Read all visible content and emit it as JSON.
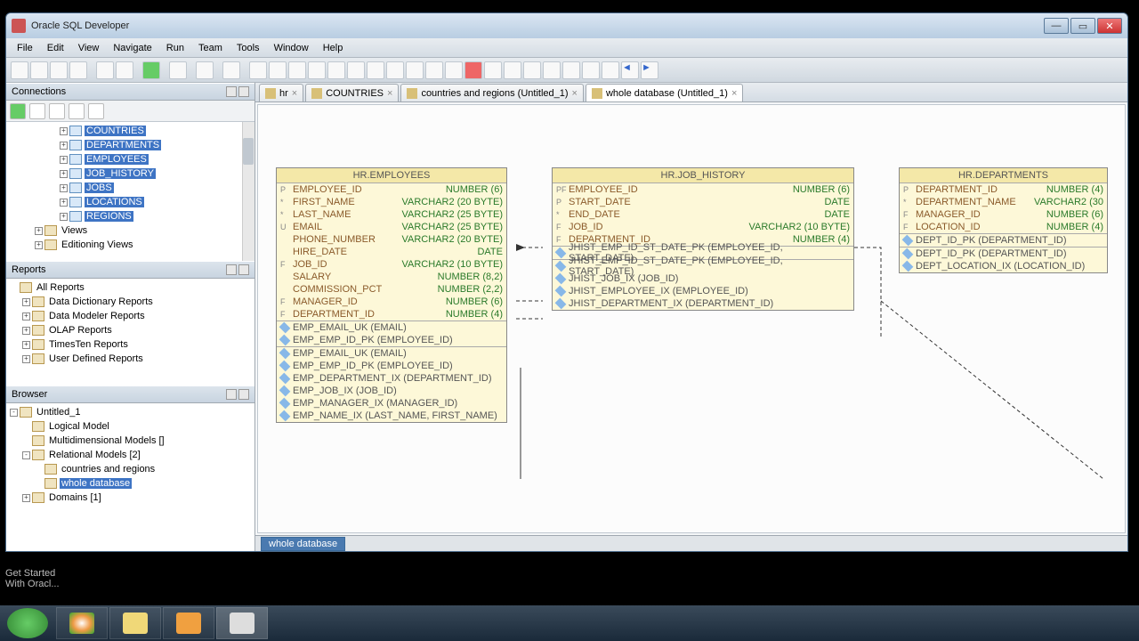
{
  "title": "Oracle SQL Developer",
  "menu": [
    "File",
    "Edit",
    "View",
    "Navigate",
    "Run",
    "Team",
    "Tools",
    "Window",
    "Help"
  ],
  "footer_lines": [
    "Get Started",
    "With Oracl..."
  ],
  "panels": {
    "connections": "Connections",
    "reports": "Reports",
    "browser": "Browser"
  },
  "conn_tree": [
    {
      "lvl": 4,
      "exp": "+",
      "sel": true,
      "label": "COUNTRIES",
      "type": "tbl"
    },
    {
      "lvl": 4,
      "exp": "+",
      "sel": true,
      "label": "DEPARTMENTS",
      "type": "tbl"
    },
    {
      "lvl": 4,
      "exp": "+",
      "sel": true,
      "label": "EMPLOYEES",
      "type": "tbl"
    },
    {
      "lvl": 4,
      "exp": "+",
      "sel": true,
      "label": "JOB_HISTORY",
      "type": "tbl"
    },
    {
      "lvl": 4,
      "exp": "+",
      "sel": true,
      "label": "JOBS",
      "type": "tbl"
    },
    {
      "lvl": 4,
      "exp": "+",
      "sel": true,
      "label": "LOCATIONS",
      "type": "tbl"
    },
    {
      "lvl": 4,
      "exp": "+",
      "sel": true,
      "label": "REGIONS",
      "type": "tbl"
    },
    {
      "lvl": 2,
      "exp": "+",
      "sel": false,
      "label": "Views",
      "type": "fld"
    },
    {
      "lvl": 2,
      "exp": "+",
      "sel": false,
      "label": "Editioning Views",
      "type": "fld"
    }
  ],
  "reports_tree": [
    {
      "lvl": 0,
      "exp": "",
      "label": "All Reports"
    },
    {
      "lvl": 1,
      "exp": "+",
      "label": "Data Dictionary Reports"
    },
    {
      "lvl": 1,
      "exp": "+",
      "label": "Data Modeler Reports"
    },
    {
      "lvl": 1,
      "exp": "+",
      "label": "OLAP Reports"
    },
    {
      "lvl": 1,
      "exp": "+",
      "label": "TimesTen Reports"
    },
    {
      "lvl": 1,
      "exp": "+",
      "label": "User Defined Reports"
    }
  ],
  "browser_tree": [
    {
      "lvl": 0,
      "exp": "-",
      "label": "Untitled_1",
      "sel": false
    },
    {
      "lvl": 1,
      "exp": "",
      "label": "Logical Model",
      "sel": false
    },
    {
      "lvl": 1,
      "exp": "",
      "label": "Multidimensional Models []",
      "sel": false
    },
    {
      "lvl": 1,
      "exp": "-",
      "label": "Relational Models [2]",
      "sel": false
    },
    {
      "lvl": 2,
      "exp": "",
      "label": "countries and regions",
      "sel": false
    },
    {
      "lvl": 2,
      "exp": "",
      "label": "whole database",
      "sel": true
    },
    {
      "lvl": 1,
      "exp": "+",
      "label": "Domains [1]",
      "sel": false
    }
  ],
  "tabs": [
    {
      "label": "hr",
      "active": false
    },
    {
      "label": "COUNTRIES",
      "active": false
    },
    {
      "label": "countries and regions (Untitled_1)",
      "active": false
    },
    {
      "label": "whole database (Untitled_1)",
      "active": true
    }
  ],
  "status_tab": "whole database",
  "erd": {
    "employees": {
      "title": "HR.EMPLOYEES",
      "cols": [
        {
          "k": "P",
          "n": "EMPLOYEE_ID",
          "t": "NUMBER (6)"
        },
        {
          "k": "*",
          "n": "FIRST_NAME",
          "t": "VARCHAR2 (20 BYTE)"
        },
        {
          "k": "*",
          "n": "LAST_NAME",
          "t": "VARCHAR2 (25 BYTE)"
        },
        {
          "k": "U",
          "n": "EMAIL",
          "t": "VARCHAR2 (25 BYTE)"
        },
        {
          "k": "",
          "n": "PHONE_NUMBER",
          "t": "VARCHAR2 (20 BYTE)"
        },
        {
          "k": "",
          "n": "HIRE_DATE",
          "t": "DATE"
        },
        {
          "k": "F",
          "n": "JOB_ID",
          "t": "VARCHAR2 (10 BYTE)"
        },
        {
          "k": "",
          "n": "SALARY",
          "t": "NUMBER (8,2)"
        },
        {
          "k": "",
          "n": "COMMISSION_PCT",
          "t": "NUMBER (2,2)"
        },
        {
          "k": "F",
          "n": "MANAGER_ID",
          "t": "NUMBER (6)"
        },
        {
          "k": "F",
          "n": "DEPARTMENT_ID",
          "t": "NUMBER (4)"
        }
      ],
      "idx1": [
        "EMP_EMAIL_UK (EMAIL)",
        "EMP_EMP_ID_PK (EMPLOYEE_ID)"
      ],
      "idx2": [
        "EMP_EMAIL_UK (EMAIL)",
        "EMP_EMP_ID_PK (EMPLOYEE_ID)",
        "EMP_DEPARTMENT_IX (DEPARTMENT_ID)",
        "EMP_JOB_IX (JOB_ID)",
        "EMP_MANAGER_IX (MANAGER_ID)",
        "EMP_NAME_IX (LAST_NAME, FIRST_NAME)"
      ]
    },
    "job_history": {
      "title": "HR.JOB_HISTORY",
      "cols": [
        {
          "k": "PF",
          "n": "EMPLOYEE_ID",
          "t": "NUMBER (6)"
        },
        {
          "k": "P",
          "n": "START_DATE",
          "t": "DATE"
        },
        {
          "k": "*",
          "n": "END_DATE",
          "t": "DATE"
        },
        {
          "k": "F",
          "n": "JOB_ID",
          "t": "VARCHAR2 (10 BYTE)"
        },
        {
          "k": "F",
          "n": "DEPARTMENT_ID",
          "t": "NUMBER (4)"
        }
      ],
      "idx1": [
        "JHIST_EMP_ID_ST_DATE_PK (EMPLOYEE_ID, START_DATE)"
      ],
      "idx2": [
        "JHIST_EMP_ID_ST_DATE_PK (EMPLOYEE_ID, START_DATE)",
        "JHIST_JOB_IX (JOB_ID)",
        "JHIST_EMPLOYEE_IX (EMPLOYEE_ID)",
        "JHIST_DEPARTMENT_IX (DEPARTMENT_ID)"
      ]
    },
    "departments": {
      "title": "HR.DEPARTMENTS",
      "cols": [
        {
          "k": "P",
          "n": "DEPARTMENT_ID",
          "t": "NUMBER (4)"
        },
        {
          "k": "*",
          "n": "DEPARTMENT_NAME",
          "t": "VARCHAR2 (30"
        },
        {
          "k": "F",
          "n": "MANAGER_ID",
          "t": "NUMBER (6)"
        },
        {
          "k": "F",
          "n": "LOCATION_ID",
          "t": "NUMBER (4)"
        }
      ],
      "idx1": [
        "DEPT_ID_PK (DEPARTMENT_ID)"
      ],
      "idx2": [
        "DEPT_ID_PK (DEPARTMENT_ID)",
        "DEPT_LOCATION_IX (LOCATION_ID)"
      ]
    }
  }
}
